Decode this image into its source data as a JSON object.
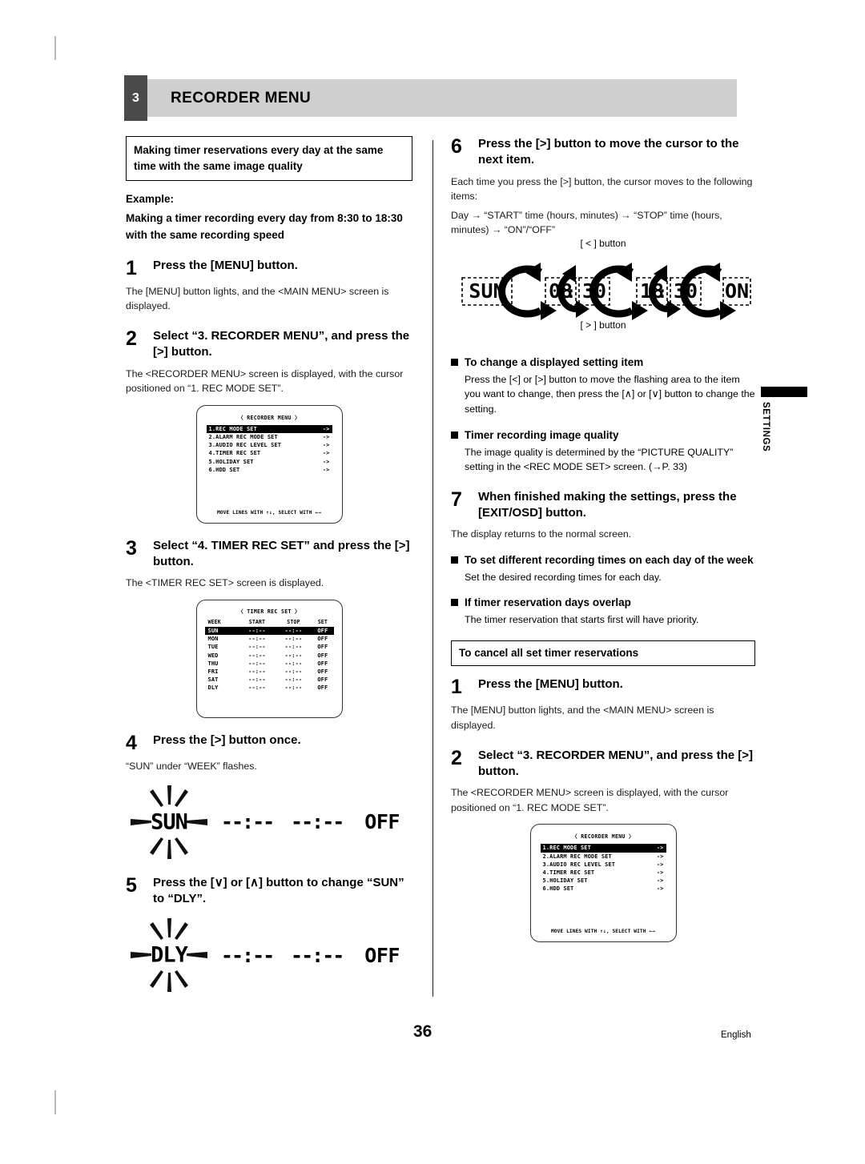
{
  "header": {
    "chapter_number": "3",
    "chapter_title": "RECORDER MENU"
  },
  "side_tab": {
    "label": "SETTINGS"
  },
  "footer": {
    "page_number": "36",
    "language": "English"
  },
  "left_column": {
    "section_box": "Making timer reservations every day at the same time with the same image quality",
    "example_label": "Example:",
    "example_text": "Making a timer recording every day from 8:30 to 18:30 with the same recording speed",
    "steps": [
      {
        "num": "1",
        "title": "Press the [MENU] button.",
        "body": "The [MENU] button lights, and the <MAIN MENU> screen is displayed."
      },
      {
        "num": "2",
        "title": "Select “3. RECORDER MENU”, and press the [>] button.",
        "body": "The <RECORDER MENU> screen is displayed, with the cursor positioned on “1. REC MODE SET”."
      },
      {
        "num": "3",
        "title": "Select “4. TIMER REC SET” and press the [>] button.",
        "body": "The <TIMER REC SET> screen is displayed."
      },
      {
        "num": "4",
        "title": "Press the [>] button once.",
        "body": "“SUN” under “WEEK” flashes."
      },
      {
        "num": "5",
        "title": "Press the [∨] or [∧] button to change “SUN” to “DLY”.",
        "body": ""
      }
    ],
    "flash_display_1": {
      "word": "SUN",
      "start": "--:--",
      "stop": "--:--",
      "set": "OFF"
    },
    "flash_display_2": {
      "word": "DLY",
      "start": "--:--",
      "stop": "--:--",
      "set": "OFF"
    }
  },
  "right_column": {
    "steps": [
      {
        "num": "6",
        "title": "Press the [>] button to move the cursor to the next item.",
        "body": "Each time you press the [>] button, the cursor moves to the following items:",
        "body2": "Day → “START” time (hours, minutes) → “STOP” time (hours, minutes) → “ON”/“OFF”"
      },
      {
        "num": "7",
        "title": "When finished making the settings, press the [EXIT/OSD] button.",
        "body": "The display returns to the normal screen."
      }
    ],
    "cycle_diagram": {
      "label_top": "[ < ] button",
      "label_bottom": "[ > ] button",
      "items": [
        "SUN",
        "08",
        "30",
        "18",
        "30",
        "ON"
      ]
    },
    "notes": [
      {
        "heading": "To change a displayed setting item",
        "body": "Press the [<] or [>] button to move the flashing area to the item you want to change, then press the [∧] or [∨] button to change the setting."
      },
      {
        "heading": "Timer recording image quality",
        "body": "The image quality is determined by the “PICTURE QUALITY” setting in the <REC MODE SET> screen. (→P. 33)"
      },
      {
        "heading": "To set different recording times on each day of the week",
        "body": "Set the desired recording times for each day."
      },
      {
        "heading": "If timer reservation days overlap",
        "body": "The timer reservation that starts first will have priority."
      }
    ],
    "cancel_box": "To cancel all set timer reservations",
    "cancel_steps": [
      {
        "num": "1",
        "title": "Press the [MENU] button.",
        "body": "The [MENU] button lights, and the <MAIN MENU> screen is displayed."
      },
      {
        "num": "2",
        "title": "Select “3. RECORDER MENU”, and press the [>] button.",
        "body": "The <RECORDER MENU> screen is displayed, with the cursor positioned on “1. REC MODE SET”."
      }
    ]
  },
  "osd_recorder_menu": {
    "title": "〈 RECORDER MENU 〉",
    "items": [
      {
        "label": "1.REC MODE SET",
        "arrow": "->",
        "selected": true
      },
      {
        "label": "2.ALARM REC MODE SET",
        "arrow": "->",
        "selected": false
      },
      {
        "label": "3.AUDIO REC LEVEL SET",
        "arrow": "->",
        "selected": false
      },
      {
        "label": "4.TIMER REC SET",
        "arrow": "->",
        "selected": false
      },
      {
        "label": "5.HOLIDAY SET",
        "arrow": "->",
        "selected": false
      },
      {
        "label": "6.HDD SET",
        "arrow": "->",
        "selected": false
      }
    ],
    "footer": "MOVE LINES WITH ↑↓, SELECT WITH ←→"
  },
  "osd_timer_rec_set": {
    "title": "〈 TIMER REC SET 〉",
    "columns": [
      "WEEK",
      "START",
      "STOP",
      "SET"
    ],
    "rows": [
      {
        "week": "SUN",
        "start": "--:--",
        "stop": "--:--",
        "set": "OFF",
        "selected": true
      },
      {
        "week": "MON",
        "start": "--:--",
        "stop": "--:--",
        "set": "OFF",
        "selected": false
      },
      {
        "week": "TUE",
        "start": "--:--",
        "stop": "--:--",
        "set": "OFF",
        "selected": false
      },
      {
        "week": "WED",
        "start": "--:--",
        "stop": "--:--",
        "set": "OFF",
        "selected": false
      },
      {
        "week": "THU",
        "start": "--:--",
        "stop": "--:--",
        "set": "OFF",
        "selected": false
      },
      {
        "week": "FRI",
        "start": "--:--",
        "stop": "--:--",
        "set": "OFF",
        "selected": false
      },
      {
        "week": "SAT",
        "start": "--:--",
        "stop": "--:--",
        "set": "OFF",
        "selected": false
      },
      {
        "week": "DLY",
        "start": "--:--",
        "stop": "--:--",
        "set": "OFF",
        "selected": false
      }
    ]
  }
}
